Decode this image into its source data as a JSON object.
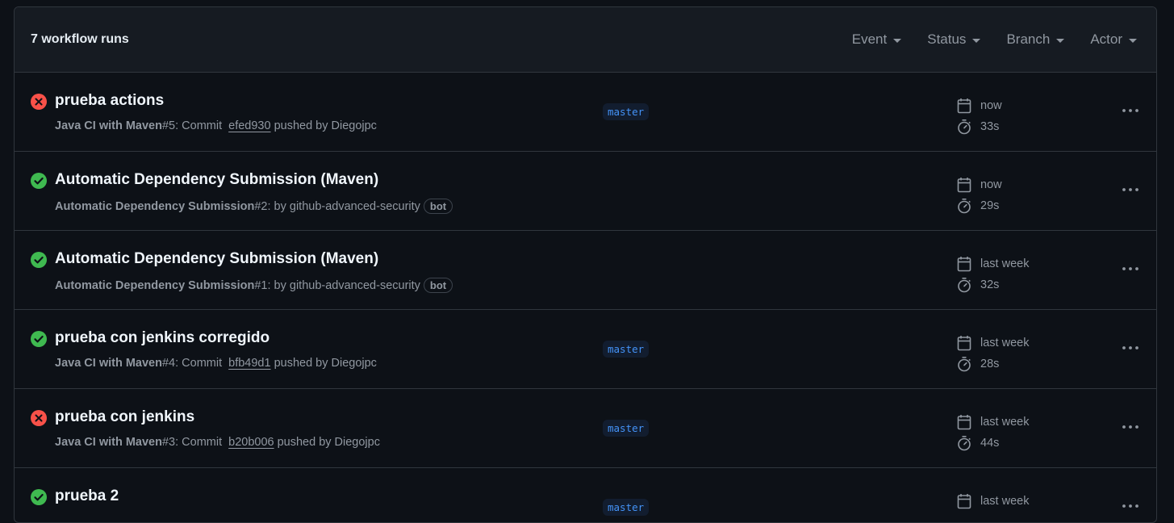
{
  "header": {
    "runs_count": "7 workflow runs"
  },
  "filters": [
    {
      "label": "Event"
    },
    {
      "label": "Status"
    },
    {
      "label": "Branch"
    },
    {
      "label": "Actor"
    }
  ],
  "colors": {
    "failure": "#f85149",
    "success": "#3fb950",
    "branch": "#4493f8"
  },
  "runs": [
    {
      "status": "failure",
      "title": "prueba actions",
      "workflow": "Java CI with Maven",
      "number": "#5",
      "verb": ": Commit",
      "sha": "efed930",
      "by": "pushed by Diegojpc",
      "bot": "",
      "branch": "master",
      "when": "now",
      "duration": "33s"
    },
    {
      "status": "success",
      "title": "Automatic Dependency Submission (Maven)",
      "workflow": "Automatic Dependency Submission",
      "number": "#2",
      "verb": ": by github-advanced-security",
      "sha": "",
      "by": "",
      "bot": "bot",
      "branch": "",
      "when": "now",
      "duration": "29s"
    },
    {
      "status": "success",
      "title": "Automatic Dependency Submission (Maven)",
      "workflow": "Automatic Dependency Submission",
      "number": "#1",
      "verb": ": by github-advanced-security",
      "sha": "",
      "by": "",
      "bot": "bot",
      "branch": "",
      "when": "last week",
      "duration": "32s"
    },
    {
      "status": "success",
      "title": "prueba con jenkins corregido",
      "workflow": "Java CI with Maven",
      "number": "#4",
      "verb": ": Commit",
      "sha": "bfb49d1",
      "by": "pushed by Diegojpc",
      "bot": "",
      "branch": "master",
      "when": "last week",
      "duration": "28s"
    },
    {
      "status": "failure",
      "title": "prueba con jenkins",
      "workflow": "Java CI with Maven",
      "number": "#3",
      "verb": ": Commit",
      "sha": "b20b006",
      "by": "pushed by Diegojpc",
      "bot": "",
      "branch": "master",
      "when": "last week",
      "duration": "44s"
    },
    {
      "status": "success",
      "title": "prueba 2",
      "workflow": "",
      "number": "",
      "verb": "",
      "sha": "",
      "by": "",
      "bot": "",
      "branch": "master",
      "when": "last week",
      "duration": ""
    }
  ]
}
